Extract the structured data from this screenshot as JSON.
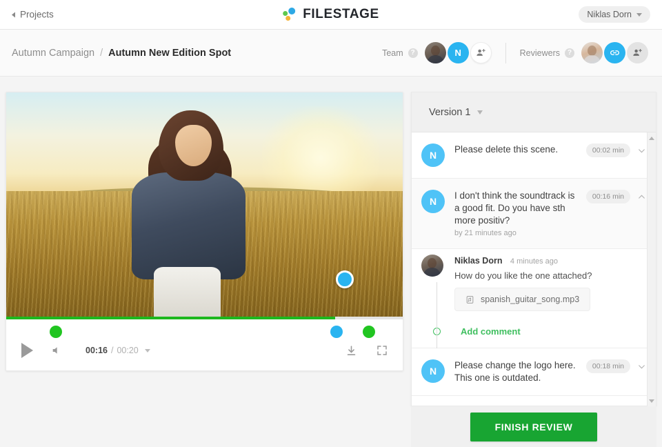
{
  "topbar": {
    "back_label": "Projects",
    "back_icon": "triangle-left-icon",
    "logo_text": "FILESTAGE",
    "logo_colors": {
      "green": "#5ec84f",
      "blue": "#2ea9e5",
      "yellow": "#f5b53a"
    },
    "user_name": "Niklas Dorn",
    "user_caret_icon": "caret-down-icon"
  },
  "subheader": {
    "breadcrumb_parent": "Autumn Campaign",
    "breadcrumb_separator": "/",
    "breadcrumb_current": "Autumn New Edition Spot",
    "team": {
      "label": "Team",
      "help_icon": "question-mark-icon",
      "members": [
        {
          "type": "photo",
          "name": "team-member-photo"
        },
        {
          "type": "initial",
          "initial": "N",
          "name": "team-member-initial"
        },
        {
          "type": "add",
          "name": "add-team-member-button",
          "icon": "add-person-icon"
        }
      ]
    },
    "reviewers": {
      "label": "Reviewers",
      "help_icon": "question-mark-icon",
      "members": [
        {
          "type": "photo",
          "name": "reviewer-photo"
        },
        {
          "type": "link",
          "name": "share-link-button",
          "icon": "link-icon"
        },
        {
          "type": "add",
          "name": "add-reviewer-button",
          "icon": "add-person-icon"
        }
      ]
    }
  },
  "player": {
    "current_time": "00:16",
    "time_separator": "/",
    "total_time": "00:20",
    "progress_percent": 83,
    "play_icon": "play-icon",
    "volume_icon": "volume-icon",
    "download_icon": "download-icon",
    "fullscreen_icon": "fullscreen-icon",
    "speed_caret_icon": "caret-down-icon",
    "video_marker": {
      "color": "#2ab4f0",
      "name": "video-annotation-marker"
    },
    "timeline_markers": [
      {
        "position_percent": 12.6,
        "color": "#21c521",
        "name": "timeline-marker-green-1"
      },
      {
        "position_percent": 83.3,
        "color": "#2ab4f0",
        "name": "timeline-marker-blue"
      },
      {
        "position_percent": 91.5,
        "color": "#21c521",
        "name": "timeline-marker-green-2"
      }
    ]
  },
  "comments": {
    "version_label": "Version 1",
    "version_caret_icon": "caret-down-icon",
    "items": [
      {
        "avatar_initial": "N",
        "text": "Please delete this scene.",
        "timestamp": "00:02 min",
        "expanded": false,
        "chevron_icon": "chevron-down-icon"
      },
      {
        "avatar_initial": "N",
        "text": "I don't think the soundtrack is a good fit. Do you have sth more positiv?",
        "meta": "by 21 minutes ago",
        "timestamp": "00:16 min",
        "expanded": true,
        "chevron_icon": "chevron-up-icon"
      },
      {
        "avatar_initial": "N",
        "text": "Please change the logo here. This one is outdated.",
        "timestamp": "00:18 min",
        "expanded": false,
        "chevron_icon": "chevron-down-icon"
      }
    ],
    "thread": {
      "reply_author": "Niklas Dorn",
      "reply_time": "4 minutes ago",
      "reply_text": "How do you like the one attached?",
      "attachment_name": "spanish_guitar_song.mp3",
      "attachment_icon": "audio-file-icon",
      "add_comment_label": "Add comment",
      "add_comment_icon": "circle-outline-icon"
    },
    "scrollbar": {
      "up_icon": "scroll-up-arrow-icon",
      "down_icon": "scroll-down-arrow-icon"
    }
  },
  "footer": {
    "finish_label": "FINISH REVIEW",
    "finish_color": "#18a532"
  }
}
